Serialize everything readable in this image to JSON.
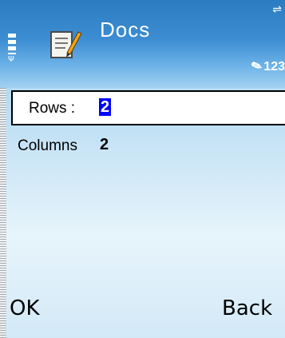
{
  "header": {
    "title": "Docs",
    "input_mode": "123",
    "icons": {
      "signal": "signal-strength-icon",
      "app": "docs-app-icon",
      "indicator": "connection-indicator-icon",
      "pen": "pen-icon"
    }
  },
  "form": {
    "rows": {
      "label": "Rows :",
      "value": "2"
    },
    "columns": {
      "label": "Columns",
      "value": "2"
    }
  },
  "softkeys": {
    "left": "OK",
    "right": "Back"
  },
  "colors": {
    "header_blue": "#3c8dd1",
    "selection": "#0000ff",
    "background": "#e7f4fb"
  }
}
